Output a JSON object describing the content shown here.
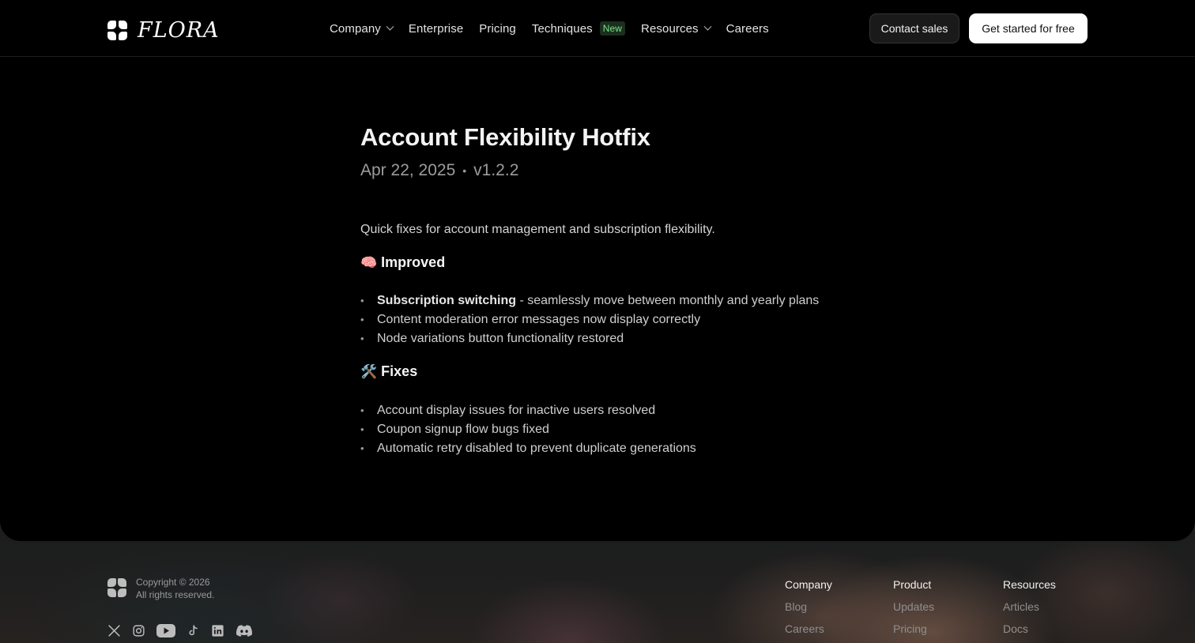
{
  "nav": {
    "logo_text": "FLORA",
    "items": [
      {
        "label": "Company",
        "has_dropdown": true
      },
      {
        "label": "Enterprise",
        "has_dropdown": false
      },
      {
        "label": "Pricing",
        "has_dropdown": false
      },
      {
        "label": "Techniques",
        "has_dropdown": false,
        "badge": "New"
      },
      {
        "label": "Resources",
        "has_dropdown": true
      },
      {
        "label": "Careers",
        "has_dropdown": false
      }
    ],
    "contact_label": "Contact sales",
    "start_label": "Get started for free"
  },
  "article": {
    "title": "Account Flexibility Hotfix",
    "date": "Apr 22, 2025",
    "separator": "•",
    "version": "v1.2.2",
    "intro": "Quick fixes for account management and subscription flexibility.",
    "improved": {
      "emoji": "🧠",
      "heading": "Improved",
      "items": [
        {
          "bold": "Subscription switching",
          "text": " - seamlessly move between monthly and yearly plans"
        },
        {
          "bold": "",
          "text": "Content moderation error messages now display correctly"
        },
        {
          "bold": "",
          "text": "Node variations button functionality restored"
        }
      ]
    },
    "fixes": {
      "emoji": "🛠️",
      "heading": "Fixes",
      "items": [
        "Account display issues for inactive users resolved",
        "Coupon signup flow bugs fixed",
        "Automatic retry disabled to prevent duplicate generations"
      ]
    }
  },
  "footer": {
    "copyright": "Copyright © 2026",
    "rights": "All rights reserved.",
    "socials": [
      "x-icon",
      "instagram-icon",
      "youtube-icon",
      "tiktok-icon",
      "linkedin-icon",
      "discord-icon"
    ],
    "columns": [
      {
        "heading": "Company",
        "links": [
          "Blog",
          "Careers"
        ]
      },
      {
        "heading": "Product",
        "links": [
          "Updates",
          "Pricing"
        ]
      },
      {
        "heading": "Resources",
        "links": [
          "Articles",
          "Docs"
        ]
      }
    ]
  },
  "colors": {
    "background": "#000000",
    "badge_text": "#7ee08a",
    "badge_bg": "#1a2f1d",
    "primary_button": "#ffffff"
  }
}
